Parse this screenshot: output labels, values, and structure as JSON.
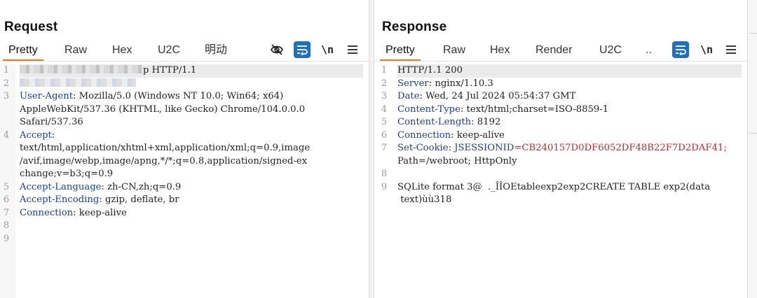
{
  "request": {
    "title": "Request",
    "tabs": [
      {
        "label": "Pretty",
        "active": true
      },
      {
        "label": "Raw",
        "active": false
      },
      {
        "label": "Hex",
        "active": false
      },
      {
        "label": "U2C",
        "active": false
      },
      {
        "label": "明动",
        "active": false
      }
    ],
    "toolbar": {
      "newline_label": "\\n"
    },
    "line_numbers": [
      "1",
      "2",
      "3",
      "",
      "",
      "4",
      "",
      "",
      "",
      "5",
      "6",
      "7",
      "8",
      "9"
    ],
    "lines": {
      "l1_suffix": "p HTTP/1.1",
      "l3a_key": "User-Agent",
      "l3a_val": ": Mozilla/5.0 (Windows NT 10.0; Win64; x64)",
      "l3b": "AppleWebKit/537.36 (KHTML, like Gecko) Chrome/104.0.0.0",
      "l3c": "Safari/537.36",
      "l4a_key": "Accept",
      "l4a_val": ":",
      "l4b": "text/html,application/xhtml+xml,application/xml;q=0.9,image",
      "l4c": "/avif,image/webp,image/apng,*/*;q=0.8,application/signed-ex",
      "l4d": "change;v=b3;q=0.9",
      "l5_key": "Accept-Language",
      "l5_val": ": zh-CN,zh;q=0.9",
      "l6_key": "Accept-Encoding",
      "l6_val": ": gzip, deflate, br",
      "l7_key": "Connection",
      "l7_val": ": keep-alive"
    }
  },
  "response": {
    "title": "Response",
    "tabs": [
      {
        "label": "Pretty",
        "active": true
      },
      {
        "label": "Raw",
        "active": false
      },
      {
        "label": "Hex",
        "active": false
      },
      {
        "label": "Render",
        "active": false
      },
      {
        "label": "U2C",
        "active": false
      },
      {
        "label": "..",
        "active": false
      }
    ],
    "toolbar": {
      "newline_label": "\\n"
    },
    "line_numbers": [
      "1",
      "2",
      "3",
      "4",
      "5",
      "6",
      "7",
      "",
      "8",
      "9",
      ""
    ],
    "lines": {
      "l1": "HTTP/1.1 200",
      "l2_key": "Server",
      "l2_val": ": nginx/1.10.3",
      "l3_key": "Date",
      "l3_val": ": Wed, 24 Jul 2024 05:54:37 GMT",
      "l4_key": "Content-Type",
      "l4_val": ": text/html;charset=ISO-8859-1",
      "l5_key": "Content-Length",
      "l5_val": ": 8192",
      "l6_key": "Connection",
      "l6_val": ": keep-alive",
      "l7_key": "Set-Cookie",
      "l7_sep": ": ",
      "l7_cookie_name": "JSESSIONID",
      "l7_eq": "=",
      "l7_cookie_val": "CB240157D0DF6052DF48B22F7D2DAF41",
      "l7_tail": ";",
      "l7b": "Path=/webroot; HttpOnly",
      "l9a": "SQLite format 3@  ._ÎÎOEtableexp2exp2CREATE TABLE exp2(data",
      "l9b": " text)ùù318"
    }
  },
  "colors": {
    "accent_tab": "#f07820",
    "button_blue": "#1f6fbf",
    "header_key": "#1a3fa0",
    "cookie_value": "#c22a2a"
  }
}
